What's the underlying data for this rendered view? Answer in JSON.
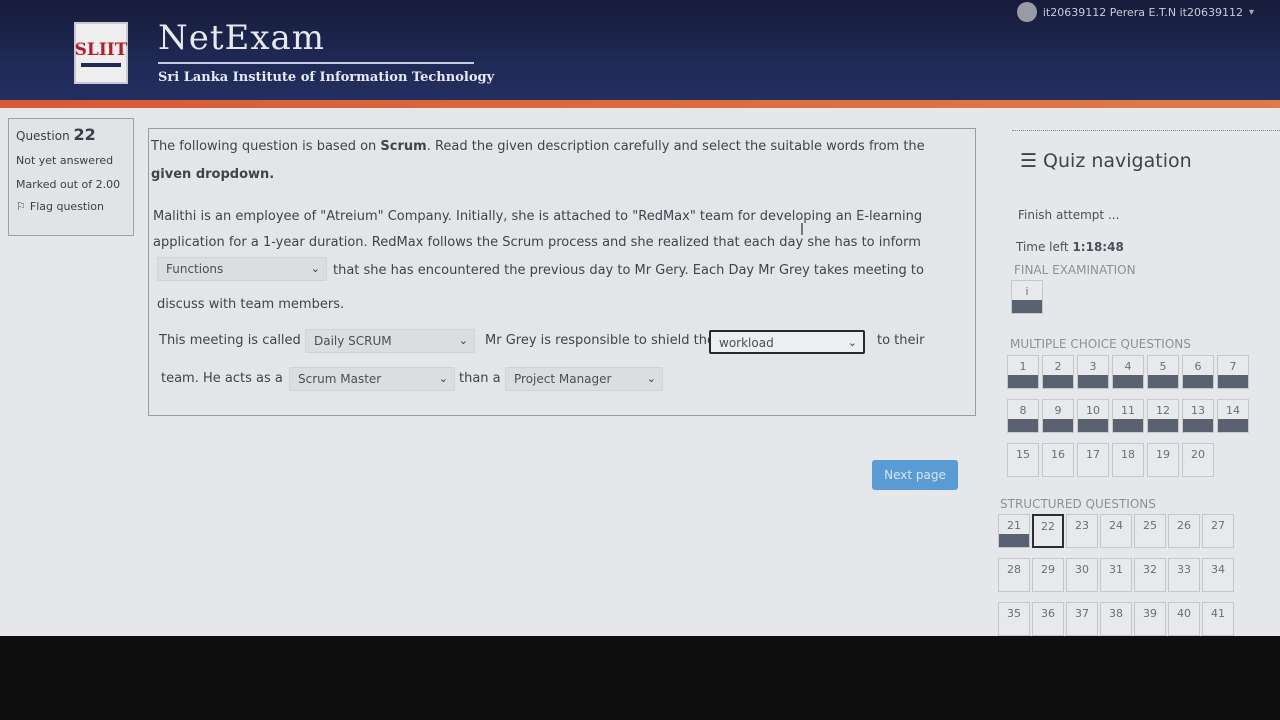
{
  "header": {
    "user": "it20639112 Perera E.T.N it20639112",
    "logo_text": "SLIIT",
    "brand": "NetExam",
    "subtitle": "Sri Lanka Institute of Information Technology"
  },
  "question_info": {
    "label": "Question",
    "number": "22",
    "status": "Not yet answered",
    "marked": "Marked out of 2.00",
    "flag": "Flag question"
  },
  "question": {
    "intro_1": "The following question is based on",
    "intro_bold": "Scrum",
    "intro_2": ". Read the given description carefully and select the suitable words from the",
    "intro_3": "given dropdown.",
    "line_1": "Malithi is an employee of \"Atreium\" Company. Initially, she is attached to \"RedMax\" team for developing an E-learning",
    "line_2": "application for a 1-year duration. RedMax follows the Scrum process and she realized that each day she has to inform",
    "line_3": "that she has encountered the previous day to Mr Gery. Each Day Mr Grey takes meeting to",
    "line_4": "discuss with team members.",
    "line_5a": "This meeting is called",
    "line_5b": "Mr Grey is responsible to shield the",
    "line_5c": "to their",
    "line_6a": "team. He acts as a",
    "line_6b": "than a",
    "dropdowns": [
      "Functions",
      "Daily SCRUM",
      "workload",
      "Scrum Master",
      "Project Manager"
    ]
  },
  "next_button": "Next page",
  "quiz_nav": {
    "title": "Quiz navigation",
    "finish": "Finish attempt ...",
    "time_label": "Time left",
    "time_value": "1:18:48",
    "sec_final": "FINAL EXAMINATION",
    "final_buttons": [
      "i"
    ],
    "sec_mcq": "MULTIPLE CHOICE QUESTIONS",
    "mcq_buttons": [
      "1",
      "2",
      "3",
      "4",
      "5",
      "6",
      "7",
      "8",
      "9",
      "10",
      "11",
      "12",
      "13",
      "14",
      "15",
      "16",
      "17",
      "18",
      "19",
      "20"
    ],
    "sec_struct": "STRUCTURED QUESTIONS",
    "struct_buttons": [
      "21",
      "22",
      "23",
      "24",
      "25",
      "26",
      "27",
      "28",
      "29",
      "30",
      "31",
      "32",
      "33",
      "34",
      "35",
      "36",
      "37",
      "38",
      "39",
      "40",
      "41"
    ]
  }
}
